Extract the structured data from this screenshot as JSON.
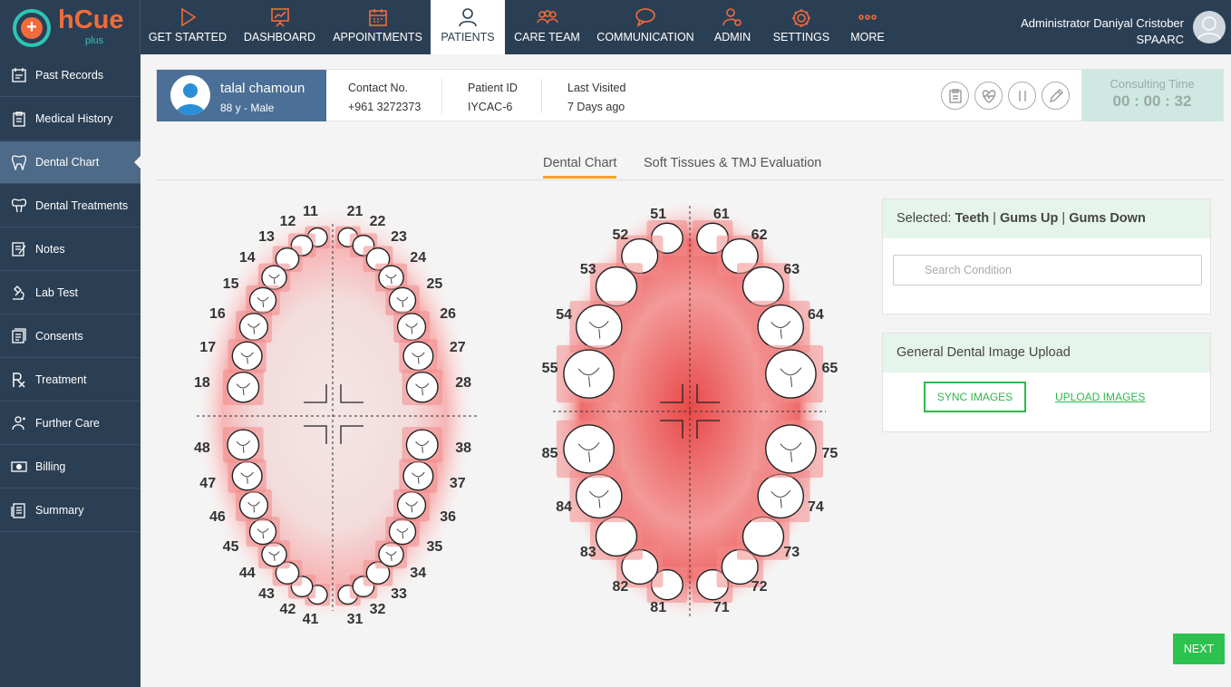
{
  "brand": {
    "name": "hCue",
    "sub": "plus"
  },
  "nav": [
    {
      "label": "GET STARTED",
      "icon": "play-icon"
    },
    {
      "label": "DASHBOARD",
      "icon": "presentation-icon"
    },
    {
      "label": "APPOINTMENTS",
      "icon": "calendar-icon"
    },
    {
      "label": "PATIENTS",
      "icon": "person-icon",
      "active": true
    },
    {
      "label": "CARE TEAM",
      "icon": "team-icon"
    },
    {
      "label": "COMMUNICATION",
      "icon": "chat-icon"
    },
    {
      "label": "ADMIN",
      "icon": "admin-icon"
    },
    {
      "label": "SETTINGS",
      "icon": "gear-icon"
    },
    {
      "label": "MORE",
      "icon": "more-icon"
    }
  ],
  "user": {
    "name": "Administrator Daniyal Cristober",
    "org": "SPAARC"
  },
  "sidebar": [
    {
      "label": "Past Records",
      "icon": "records-icon"
    },
    {
      "label": "Medical History",
      "icon": "clipboard-icon"
    },
    {
      "label": "Dental Chart",
      "icon": "tooth-icon",
      "active": true
    },
    {
      "label": "Dental Treatments",
      "icon": "treatment-tooth-icon"
    },
    {
      "label": "Notes",
      "icon": "notes-icon"
    },
    {
      "label": "Lab Test",
      "icon": "microscope-icon"
    },
    {
      "label": "Consents",
      "icon": "consent-icon"
    },
    {
      "label": "Treatment",
      "icon": "rx-icon"
    },
    {
      "label": "Further Care",
      "icon": "care-icon"
    },
    {
      "label": "Billing",
      "icon": "billing-icon"
    },
    {
      "label": "Summary",
      "icon": "summary-icon"
    }
  ],
  "patient": {
    "name": "talal chamoun",
    "age_gender": "88 y - Male",
    "contact_label": "Contact No.",
    "contact": "+961 3272373",
    "id_label": "Patient ID",
    "id": "IYCAC-6",
    "visited_label": "Last Visited",
    "visited": "7 Days ago"
  },
  "consult": {
    "label": "Consulting Time",
    "time": "00 : 00 : 32"
  },
  "tabs": [
    {
      "label": "Dental Chart",
      "active": true
    },
    {
      "label": "Soft Tissues & TMJ Evaluation"
    }
  ],
  "permanent_teeth": [
    "11",
    "12",
    "13",
    "14",
    "15",
    "16",
    "17",
    "18",
    "21",
    "22",
    "23",
    "24",
    "25",
    "26",
    "27",
    "28",
    "31",
    "32",
    "33",
    "34",
    "35",
    "36",
    "37",
    "38",
    "41",
    "42",
    "43",
    "44",
    "45",
    "46",
    "47",
    "48"
  ],
  "primary_teeth": [
    "51",
    "52",
    "53",
    "54",
    "55",
    "61",
    "62",
    "63",
    "64",
    "65",
    "71",
    "72",
    "73",
    "74",
    "75",
    "81",
    "82",
    "83",
    "84",
    "85"
  ],
  "selection": {
    "prefix": "Selected: ",
    "teeth": "Teeth",
    "sep1": " | ",
    "gums_up": "Gums Up",
    "sep2": " | ",
    "gums_down": "Gums Down"
  },
  "search": {
    "placeholder": "Search Condition"
  },
  "upload": {
    "title": "General Dental Image Upload",
    "sync": "SYNC IMAGES",
    "upload": "UPLOAD IMAGES"
  },
  "next": "NEXT",
  "colors": {
    "topbar": "#2b3f54",
    "accent": "#f26b3a",
    "teal": "#2ec4b6",
    "green": "#2dc24f",
    "highlight": "#f5a623"
  }
}
